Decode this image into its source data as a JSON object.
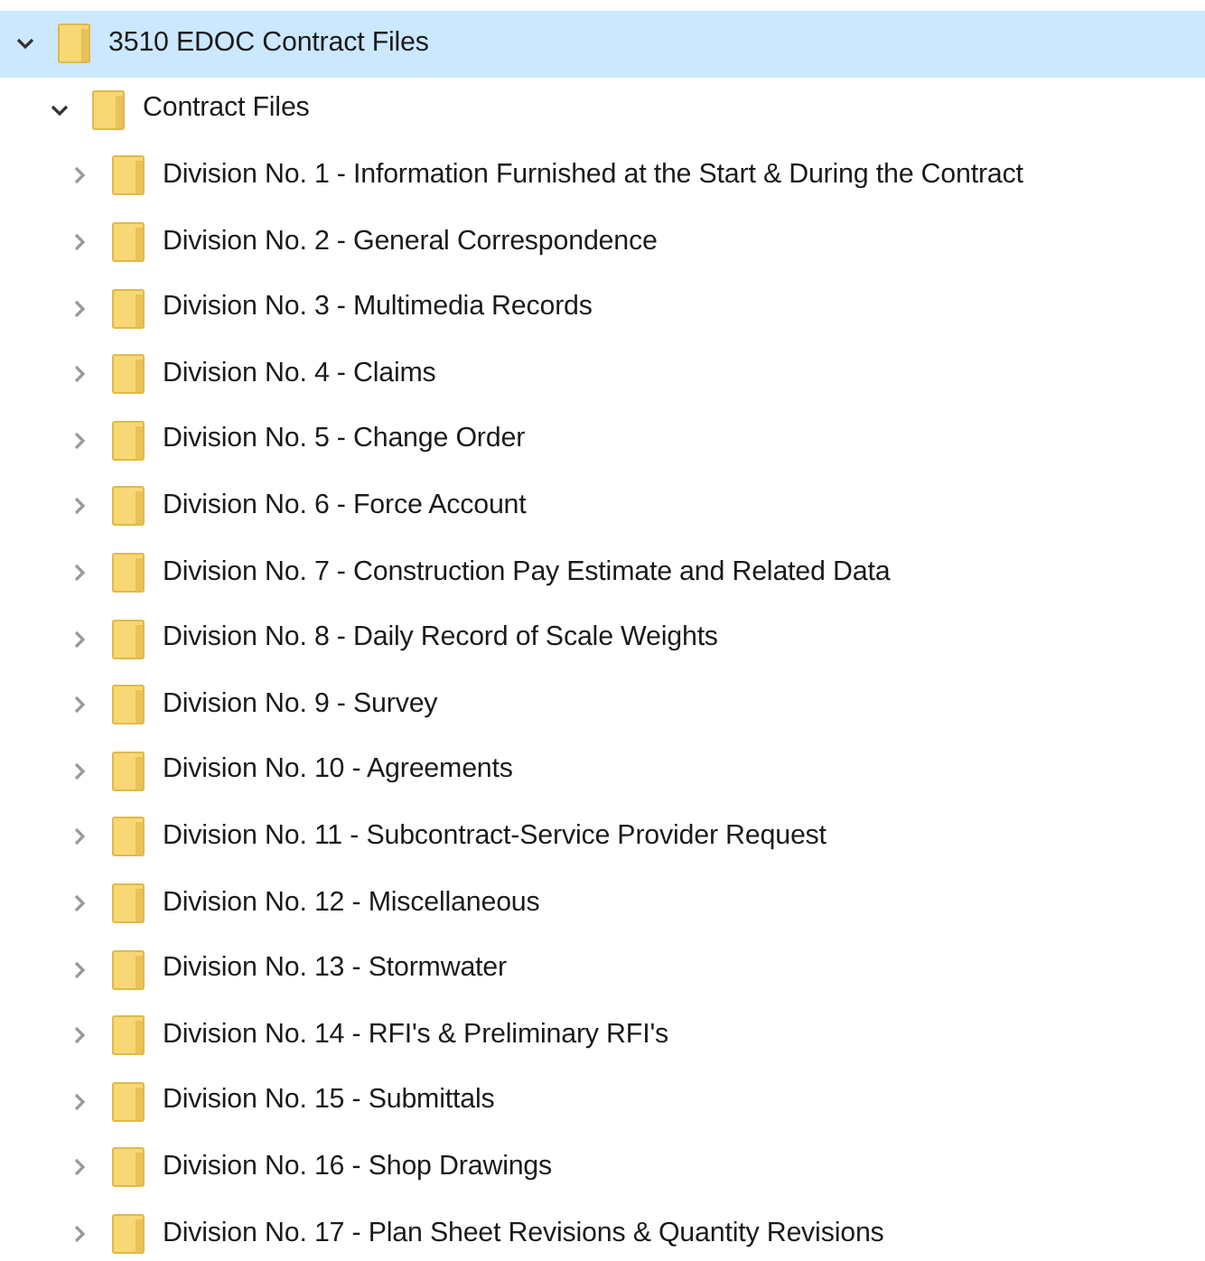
{
  "tree": [
    {
      "label": "3510 EDOC Contract Files",
      "expanded": true,
      "selected": true,
      "children": [
        {
          "label": "Contract Files",
          "expanded": true,
          "selected": false,
          "children": [
            {
              "label": "Division No. 1 - Information Furnished at the Start & During the Contract",
              "expanded": false,
              "selected": false
            },
            {
              "label": "Division No. 2 - General Correspondence",
              "expanded": false,
              "selected": false
            },
            {
              "label": "Division No. 3 - Multimedia Records",
              "expanded": false,
              "selected": false
            },
            {
              "label": "Division No. 4 - Claims",
              "expanded": false,
              "selected": false
            },
            {
              "label": "Division No. 5 - Change Order",
              "expanded": false,
              "selected": false
            },
            {
              "label": "Division No. 6 - Force Account",
              "expanded": false,
              "selected": false
            },
            {
              "label": "Division No. 7 - Construction Pay Estimate and Related Data",
              "expanded": false,
              "selected": false
            },
            {
              "label": "Division No. 8 - Daily Record of Scale Weights",
              "expanded": false,
              "selected": false
            },
            {
              "label": "Division No. 9 - Survey",
              "expanded": false,
              "selected": false
            },
            {
              "label": "Division No. 10 - Agreements",
              "expanded": false,
              "selected": false
            },
            {
              "label": "Division No. 11 - Subcontract-Service Provider Request",
              "expanded": false,
              "selected": false
            },
            {
              "label": "Division No. 12 - Miscellaneous",
              "expanded": false,
              "selected": false
            },
            {
              "label": "Division No. 13 - Stormwater",
              "expanded": false,
              "selected": false
            },
            {
              "label": "Division No. 14 - RFI's & Preliminary RFI's",
              "expanded": false,
              "selected": false
            },
            {
              "label": "Division No. 15 - Submittals",
              "expanded": false,
              "selected": false
            },
            {
              "label": "Division No. 16 - Shop Drawings",
              "expanded": false,
              "selected": false
            },
            {
              "label": "Division No. 17 - Plan Sheet Revisions & Quantity Revisions",
              "expanded": false,
              "selected": false
            }
          ]
        }
      ]
    }
  ]
}
